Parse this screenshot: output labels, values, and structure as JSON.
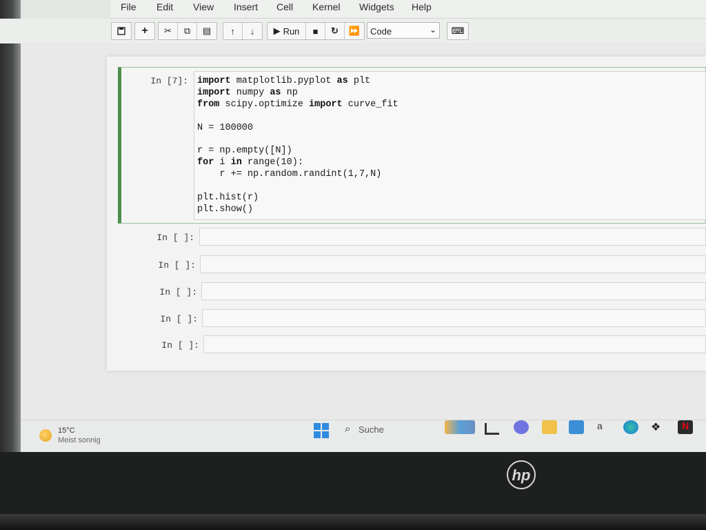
{
  "menu": [
    "File",
    "Edit",
    "View",
    "Insert",
    "Cell",
    "Kernel",
    "Widgets",
    "Help"
  ],
  "toolbar": {
    "save_icon": "save-icon",
    "run_label": "Run",
    "cell_type": "Code"
  },
  "cells": {
    "active_prompt": "In [7]:",
    "code_lines": [
      "import matplotlib.pyplot as plt",
      "import numpy as np",
      "from scipy.optimize import curve_fit",
      "",
      "N = 100000",
      "",
      "r = np.empty([N])",
      "for i in range(10):",
      "    r += np.random.randint(1,7,N)",
      "",
      "plt.hist(r)",
      "plt.show()"
    ],
    "empty_prompts": [
      "In [ ]:",
      "In [ ]:",
      "In [ ]:",
      "In [ ]:",
      "In [ ]:"
    ]
  },
  "taskbar": {
    "weather_temp": "15°C",
    "weather_desc": "Meist sonnig",
    "search_label": "Suche"
  },
  "brand": "hp"
}
